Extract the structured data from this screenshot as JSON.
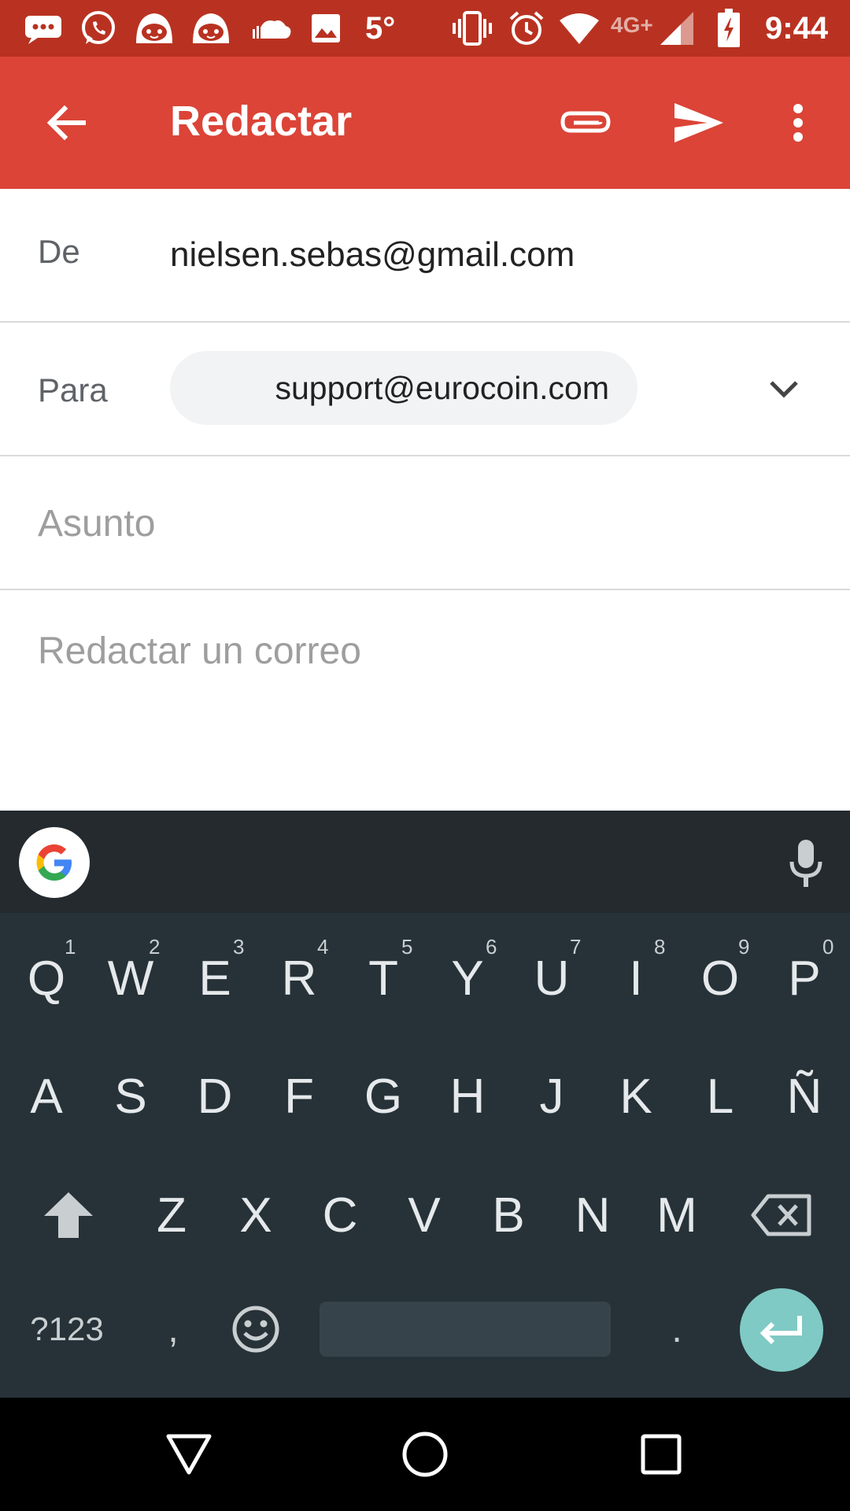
{
  "status_bar": {
    "temperature": "5°",
    "network": "4G+",
    "time": "9:44",
    "icons": [
      "messages-icon",
      "whatsapp-icon",
      "app-face-icon",
      "app-face-icon",
      "soundcloud-icon",
      "gallery-icon",
      "vibrate-icon",
      "alarm-icon",
      "wifi-icon",
      "signal-icon",
      "battery-icon"
    ]
  },
  "app_bar": {
    "title": "Redactar",
    "color": "#DB4437",
    "actions": [
      "attach-icon",
      "send-icon",
      "more-vert-icon"
    ]
  },
  "compose": {
    "from_label": "De",
    "from_value": "nielsen.sebas@gmail.com",
    "to_label": "Para",
    "to_chip": "support@eurocoin.com",
    "subject_placeholder": "Asunto",
    "body_placeholder": "Redactar un correo"
  },
  "keyboard": {
    "row1": [
      "Q",
      "W",
      "E",
      "R",
      "T",
      "Y",
      "U",
      "I",
      "O",
      "P"
    ],
    "row1_hints": [
      "1",
      "2",
      "3",
      "4",
      "5",
      "6",
      "7",
      "8",
      "9",
      "0"
    ],
    "row2": [
      "A",
      "S",
      "D",
      "F",
      "G",
      "H",
      "J",
      "K",
      "L",
      "Ñ"
    ],
    "row3": [
      "Z",
      "X",
      "C",
      "V",
      "B",
      "N",
      "M"
    ],
    "symbols_label": "?123",
    "comma": ",",
    "period": ".",
    "accent": "#7FCAC4"
  },
  "nav_bar": [
    "back-icon",
    "home-icon",
    "recents-icon"
  ]
}
